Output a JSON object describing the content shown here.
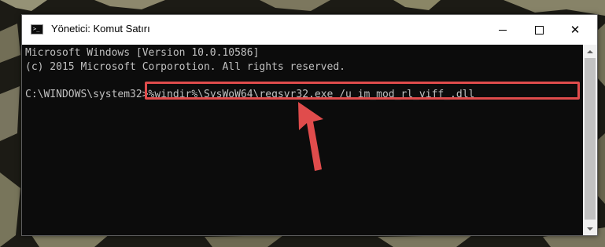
{
  "window": {
    "title": "Yönetici: Komut Satırı",
    "icon": "command-prompt-icon"
  },
  "controls": {
    "minimize_icon": "minimize-icon",
    "maximize_icon": "maximize-icon",
    "close_icon": "close-icon",
    "close_glyph": "✕"
  },
  "console": {
    "line1": "Microsoft Windows [Version 10.0.10586]",
    "line2": "(c) 2015 Microsoft Corporotion. All rights reserved.",
    "prompt": "C:\\WINDOWS\\system32>",
    "command": "%windir%\\SysWoW64\\regsvr32.exe /u im_mod_rl_viff_.dll"
  },
  "annotation": {
    "highlight_color": "#e04c4c",
    "arrow_color": "#e04c4c"
  }
}
